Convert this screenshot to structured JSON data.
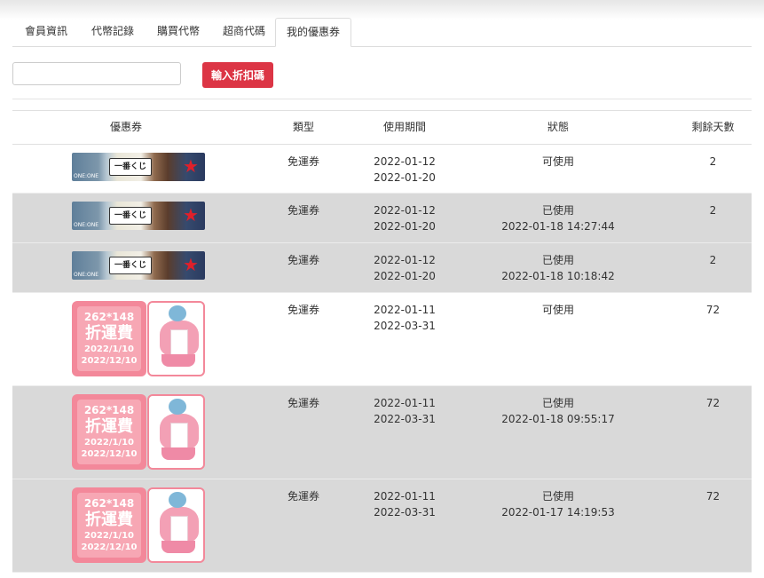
{
  "tabs": [
    {
      "label": "會員資訊",
      "active": false
    },
    {
      "label": "代幣記錄",
      "active": false
    },
    {
      "label": "購買代幣",
      "active": false
    },
    {
      "label": "超商代碼",
      "active": false
    },
    {
      "label": "我的優惠券",
      "active": true
    }
  ],
  "discount": {
    "input_value": "",
    "button_label": "輸入折扣碼"
  },
  "table": {
    "headers": [
      "優惠券",
      "類型",
      "使用期間",
      "狀態",
      "剩餘天數"
    ],
    "rows": [
      {
        "coupon": "banner",
        "type": "免運券",
        "start": "2022-01-12",
        "end": "2022-01-20",
        "status": "可使用",
        "used_at": "",
        "days": "2",
        "gray": false
      },
      {
        "coupon": "banner",
        "type": "免運券",
        "start": "2022-01-12",
        "end": "2022-01-20",
        "status": "已使用",
        "used_at": "2022-01-18 14:27:44",
        "days": "2",
        "gray": true
      },
      {
        "coupon": "banner",
        "type": "免運券",
        "start": "2022-01-12",
        "end": "2022-01-20",
        "status": "已使用",
        "used_at": "2022-01-18 10:18:42",
        "days": "2",
        "gray": true
      },
      {
        "coupon": "pink",
        "type": "免運券",
        "start": "2022-01-11",
        "end": "2022-03-31",
        "status": "可使用",
        "used_at": "",
        "days": "72",
        "gray": false
      },
      {
        "coupon": "pink",
        "type": "免運券",
        "start": "2022-01-11",
        "end": "2022-03-31",
        "status": "已使用",
        "used_at": "2022-01-18 09:55:17",
        "days": "72",
        "gray": true
      },
      {
        "coupon": "pink",
        "type": "免運券",
        "start": "2022-01-11",
        "end": "2022-03-31",
        "status": "已使用",
        "used_at": "2022-01-17 14:19:53",
        "days": "72",
        "gray": true
      }
    ]
  },
  "coupon_art": {
    "banner_logo": "一番くじ",
    "banner_small": "ONE:ONE",
    "pink_size": "262*148",
    "pink_title": "折運費",
    "pink_from": "2022/1/10",
    "pink_to": "2022/12/10"
  },
  "colors": {
    "accent": "#dc3545",
    "gray_row": "#d9d9d9",
    "coupon_pink": "#f3889a"
  }
}
